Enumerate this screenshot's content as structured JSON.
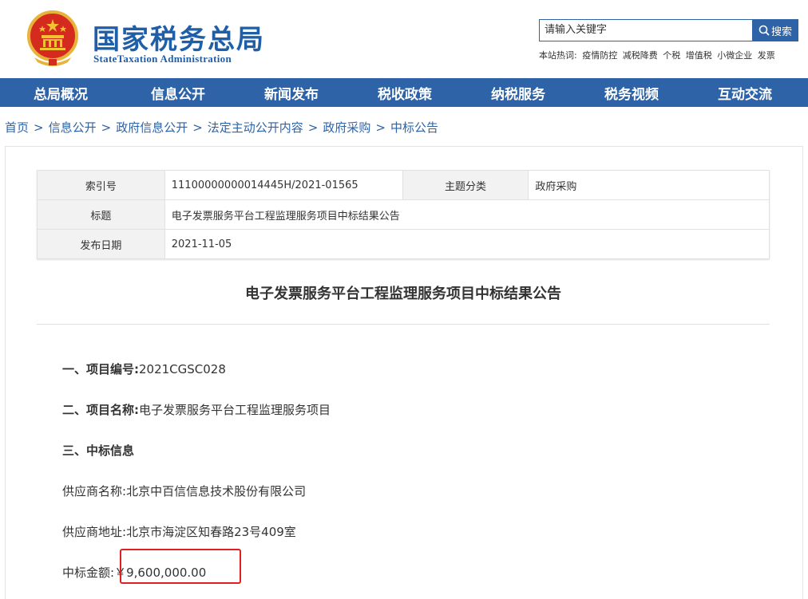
{
  "site": {
    "name_cn": "国家税务总局",
    "name_en": "StateTaxation Administration",
    "emblem_icon": "national-emblem-icon"
  },
  "search": {
    "value": "请输入关键字",
    "button_label": "搜索"
  },
  "hotwords": {
    "label": "本站热词:",
    "items": [
      "疫情防控",
      "减税降费",
      "个税",
      "增值税",
      "小微企业",
      "发票"
    ]
  },
  "nav": {
    "items": [
      "总局概况",
      "信息公开",
      "新闻发布",
      "税收政策",
      "纳税服务",
      "税务视频",
      "互动交流"
    ]
  },
  "breadcrumb": {
    "items": [
      "首页",
      "信息公开",
      "政府信息公开",
      "法定主动公开内容",
      "政府采购",
      "中标公告"
    ],
    "separator": ">"
  },
  "meta": {
    "index_label": "索引号",
    "index_value": "11100000000014445H/2021-01565",
    "topic_label": "主题分类",
    "topic_value": "政府采购",
    "title_label": "标题",
    "title_value": "电子发票服务平台工程监理服务项目中标结果公告",
    "date_label": "发布日期",
    "date_value": "2021-11-05"
  },
  "article": {
    "title": "电子发票服务平台工程监理服务项目中标结果公告",
    "project_no_label": "一、项目编号:",
    "project_no_value": "2021CGSC028",
    "project_name_label": "二、项目名称:",
    "project_name_value": "电子发票服务平台工程监理服务项目",
    "award_heading": "三、中标信息",
    "supplier_name_label": "供应商名称:",
    "supplier_name_value": "北京中百信信息技术股份有限公司",
    "supplier_addr_label": "供应商地址:",
    "supplier_addr_value": "北京市海淀区知春路23号409室",
    "amount_label": "中标金额:",
    "amount_value": "￥9,600,000.00"
  },
  "colors": {
    "brand_blue": "#2e63a8",
    "highlight_red": "#e02020"
  }
}
